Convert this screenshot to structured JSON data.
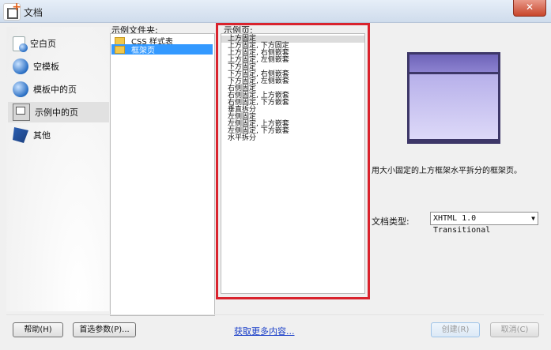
{
  "window": {
    "title": "文档",
    "close_glyph": "✕"
  },
  "sidebar": {
    "items": [
      {
        "label": "空白页",
        "icon": "globe-doc-icon"
      },
      {
        "label": "空模板",
        "icon": "globe-icon"
      },
      {
        "label": "模板中的页",
        "icon": "globe-icon"
      },
      {
        "label": "示例中的页",
        "icon": "sample-page-icon",
        "selected": true
      },
      {
        "label": "其他",
        "icon": "other-icon"
      }
    ]
  },
  "folders": {
    "label": "示例文件夹:",
    "items": [
      {
        "label": "CSS 样式表",
        "selected": false
      },
      {
        "label": "框架页",
        "selected": true
      }
    ]
  },
  "samples": {
    "label": "示例页:",
    "items": [
      "上方固定",
      "上方固定, 下方固定",
      "上方固定, 右侧嵌套",
      "上方固定, 左侧嵌套",
      "下方固定",
      "下方固定, 右侧嵌套",
      "下方固定, 左侧嵌套",
      "右侧固定",
      "右侧固定, 上方嵌套",
      "右侧固定, 下方嵌套",
      "垂直拆分",
      "左侧固定",
      "左侧固定, 上方嵌套",
      "左侧固定, 下方嵌套",
      "水平拆分"
    ],
    "selected_index": 0
  },
  "preview": {
    "description": "用大小固定的上方框架水平拆分的框架页。",
    "colors": {
      "border": "#3d3768",
      "top": "#7a70c4",
      "body": "#c8c2f2"
    }
  },
  "doctype": {
    "label": "文档类型:",
    "value": "XHTML 1.0 Transitional",
    "arrow": "▼"
  },
  "footer": {
    "help_label": "帮助(H)",
    "prefs_label": "首选参数(P)...",
    "more_link": "获取更多内容...",
    "open_label": "创建(R)",
    "cancel_label": "取消(C)"
  },
  "colors": {
    "highlight": "#d9232d",
    "selection": "#3399ff"
  }
}
